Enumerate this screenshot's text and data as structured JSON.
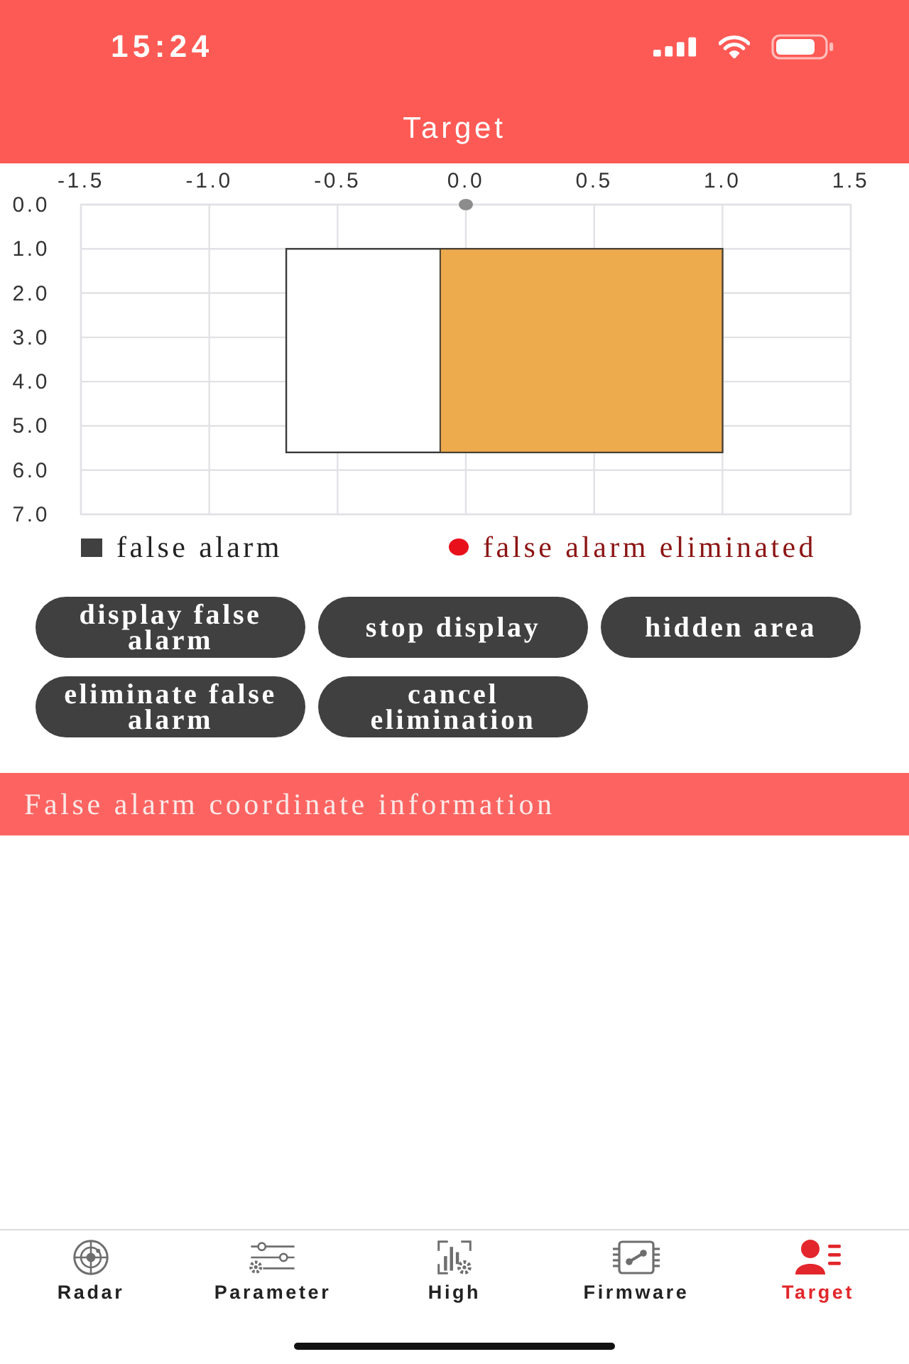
{
  "status_bar": {
    "time": "15:24"
  },
  "header": {
    "title": "Target"
  },
  "chart": {
    "chart_data": {
      "type": "scatter",
      "grid": true,
      "xlim": [
        -1.5,
        1.5
      ],
      "ylim": [
        7,
        0
      ],
      "xticks": [
        {
          "value": -1.5,
          "label": "-1.5"
        },
        {
          "value": -1,
          "label": "-1.0"
        },
        {
          "value": -0.5,
          "label": "-0.5"
        },
        {
          "value": 0,
          "label": "0.0"
        },
        {
          "value": 0.5,
          "label": "0.5"
        },
        {
          "value": 1,
          "label": "1.0"
        },
        {
          "value": 1.5,
          "label": "1.5"
        }
      ],
      "yticks": [
        {
          "value": 0,
          "label": "0.0"
        },
        {
          "value": 1,
          "label": "1.0"
        },
        {
          "value": 2,
          "label": "2.0"
        },
        {
          "value": 3,
          "label": "3.0"
        },
        {
          "value": 4,
          "label": "4.0"
        },
        {
          "value": 5,
          "label": "5.0"
        },
        {
          "value": 6,
          "label": "6.0"
        },
        {
          "value": 7,
          "label": "7.0"
        }
      ],
      "x": [
        0
      ],
      "series": [
        {
          "color": "#8c8c8c",
          "values": [
            0
          ]
        }
      ]
    }
  },
  "legend": [
    {
      "kind": "square",
      "label": "false alarm",
      "color": "#404040"
    },
    {
      "kind": "dot",
      "label": "false alarm eliminated",
      "color": "#e8101a"
    }
  ],
  "buttons": [
    {
      "label": "display false alarm"
    },
    {
      "label": "stop display"
    },
    {
      "label": "hidden area"
    },
    {
      "label": "eliminate false alarm"
    },
    {
      "label": "cancel elimination"
    }
  ],
  "section": {
    "title": "False alarm coordinate information"
  },
  "tabs": [
    {
      "label": "Radar",
      "selected": false
    },
    {
      "label": "Parameter",
      "selected": false
    },
    {
      "label": "High",
      "selected": false
    },
    {
      "label": "Firmware",
      "selected": false
    },
    {
      "label": "Target",
      "selected": true
    }
  ]
}
